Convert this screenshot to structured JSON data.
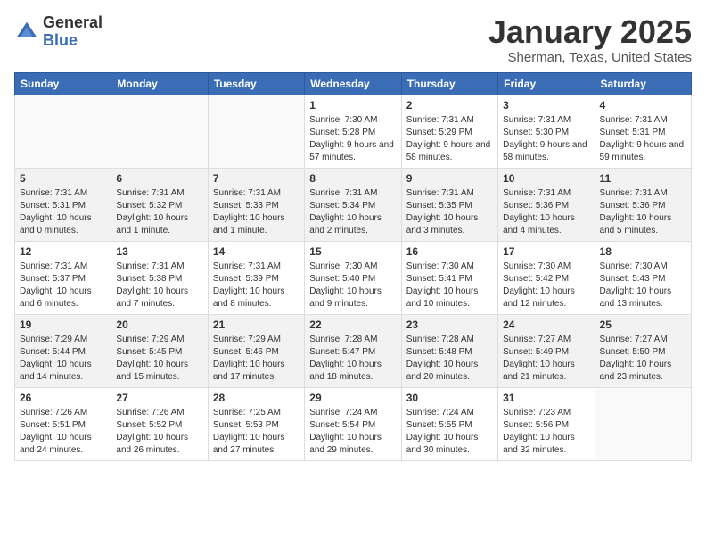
{
  "header": {
    "logo_general": "General",
    "logo_blue": "Blue",
    "title": "January 2025",
    "subtitle": "Sherman, Texas, United States"
  },
  "weekdays": [
    "Sunday",
    "Monday",
    "Tuesday",
    "Wednesday",
    "Thursday",
    "Friday",
    "Saturday"
  ],
  "weeks": [
    [
      {
        "day": "",
        "info": ""
      },
      {
        "day": "",
        "info": ""
      },
      {
        "day": "",
        "info": ""
      },
      {
        "day": "1",
        "info": "Sunrise: 7:30 AM\nSunset: 5:28 PM\nDaylight: 9 hours and 57 minutes."
      },
      {
        "day": "2",
        "info": "Sunrise: 7:31 AM\nSunset: 5:29 PM\nDaylight: 9 hours and 58 minutes."
      },
      {
        "day": "3",
        "info": "Sunrise: 7:31 AM\nSunset: 5:30 PM\nDaylight: 9 hours and 58 minutes."
      },
      {
        "day": "4",
        "info": "Sunrise: 7:31 AM\nSunset: 5:31 PM\nDaylight: 9 hours and 59 minutes."
      }
    ],
    [
      {
        "day": "5",
        "info": "Sunrise: 7:31 AM\nSunset: 5:31 PM\nDaylight: 10 hours and 0 minutes."
      },
      {
        "day": "6",
        "info": "Sunrise: 7:31 AM\nSunset: 5:32 PM\nDaylight: 10 hours and 1 minute."
      },
      {
        "day": "7",
        "info": "Sunrise: 7:31 AM\nSunset: 5:33 PM\nDaylight: 10 hours and 1 minute."
      },
      {
        "day": "8",
        "info": "Sunrise: 7:31 AM\nSunset: 5:34 PM\nDaylight: 10 hours and 2 minutes."
      },
      {
        "day": "9",
        "info": "Sunrise: 7:31 AM\nSunset: 5:35 PM\nDaylight: 10 hours and 3 minutes."
      },
      {
        "day": "10",
        "info": "Sunrise: 7:31 AM\nSunset: 5:36 PM\nDaylight: 10 hours and 4 minutes."
      },
      {
        "day": "11",
        "info": "Sunrise: 7:31 AM\nSunset: 5:36 PM\nDaylight: 10 hours and 5 minutes."
      }
    ],
    [
      {
        "day": "12",
        "info": "Sunrise: 7:31 AM\nSunset: 5:37 PM\nDaylight: 10 hours and 6 minutes."
      },
      {
        "day": "13",
        "info": "Sunrise: 7:31 AM\nSunset: 5:38 PM\nDaylight: 10 hours and 7 minutes."
      },
      {
        "day": "14",
        "info": "Sunrise: 7:31 AM\nSunset: 5:39 PM\nDaylight: 10 hours and 8 minutes."
      },
      {
        "day": "15",
        "info": "Sunrise: 7:30 AM\nSunset: 5:40 PM\nDaylight: 10 hours and 9 minutes."
      },
      {
        "day": "16",
        "info": "Sunrise: 7:30 AM\nSunset: 5:41 PM\nDaylight: 10 hours and 10 minutes."
      },
      {
        "day": "17",
        "info": "Sunrise: 7:30 AM\nSunset: 5:42 PM\nDaylight: 10 hours and 12 minutes."
      },
      {
        "day": "18",
        "info": "Sunrise: 7:30 AM\nSunset: 5:43 PM\nDaylight: 10 hours and 13 minutes."
      }
    ],
    [
      {
        "day": "19",
        "info": "Sunrise: 7:29 AM\nSunset: 5:44 PM\nDaylight: 10 hours and 14 minutes."
      },
      {
        "day": "20",
        "info": "Sunrise: 7:29 AM\nSunset: 5:45 PM\nDaylight: 10 hours and 15 minutes."
      },
      {
        "day": "21",
        "info": "Sunrise: 7:29 AM\nSunset: 5:46 PM\nDaylight: 10 hours and 17 minutes."
      },
      {
        "day": "22",
        "info": "Sunrise: 7:28 AM\nSunset: 5:47 PM\nDaylight: 10 hours and 18 minutes."
      },
      {
        "day": "23",
        "info": "Sunrise: 7:28 AM\nSunset: 5:48 PM\nDaylight: 10 hours and 20 minutes."
      },
      {
        "day": "24",
        "info": "Sunrise: 7:27 AM\nSunset: 5:49 PM\nDaylight: 10 hours and 21 minutes."
      },
      {
        "day": "25",
        "info": "Sunrise: 7:27 AM\nSunset: 5:50 PM\nDaylight: 10 hours and 23 minutes."
      }
    ],
    [
      {
        "day": "26",
        "info": "Sunrise: 7:26 AM\nSunset: 5:51 PM\nDaylight: 10 hours and 24 minutes."
      },
      {
        "day": "27",
        "info": "Sunrise: 7:26 AM\nSunset: 5:52 PM\nDaylight: 10 hours and 26 minutes."
      },
      {
        "day": "28",
        "info": "Sunrise: 7:25 AM\nSunset: 5:53 PM\nDaylight: 10 hours and 27 minutes."
      },
      {
        "day": "29",
        "info": "Sunrise: 7:24 AM\nSunset: 5:54 PM\nDaylight: 10 hours and 29 minutes."
      },
      {
        "day": "30",
        "info": "Sunrise: 7:24 AM\nSunset: 5:55 PM\nDaylight: 10 hours and 30 minutes."
      },
      {
        "day": "31",
        "info": "Sunrise: 7:23 AM\nSunset: 5:56 PM\nDaylight: 10 hours and 32 minutes."
      },
      {
        "day": "",
        "info": ""
      }
    ]
  ]
}
